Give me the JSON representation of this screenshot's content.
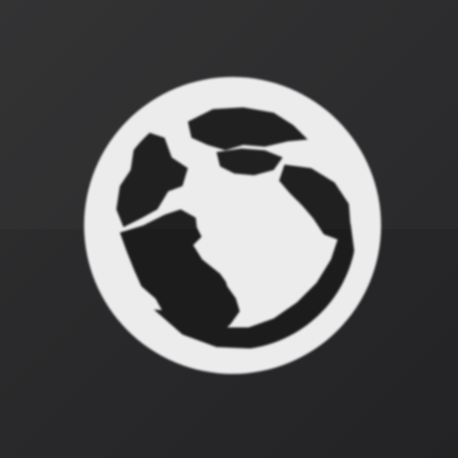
{
  "app_icon": {
    "icon": "globe-icon",
    "icon_color": "#ededed",
    "land_color": "#1c1c1d",
    "background_color": "#2a2a2b"
  }
}
